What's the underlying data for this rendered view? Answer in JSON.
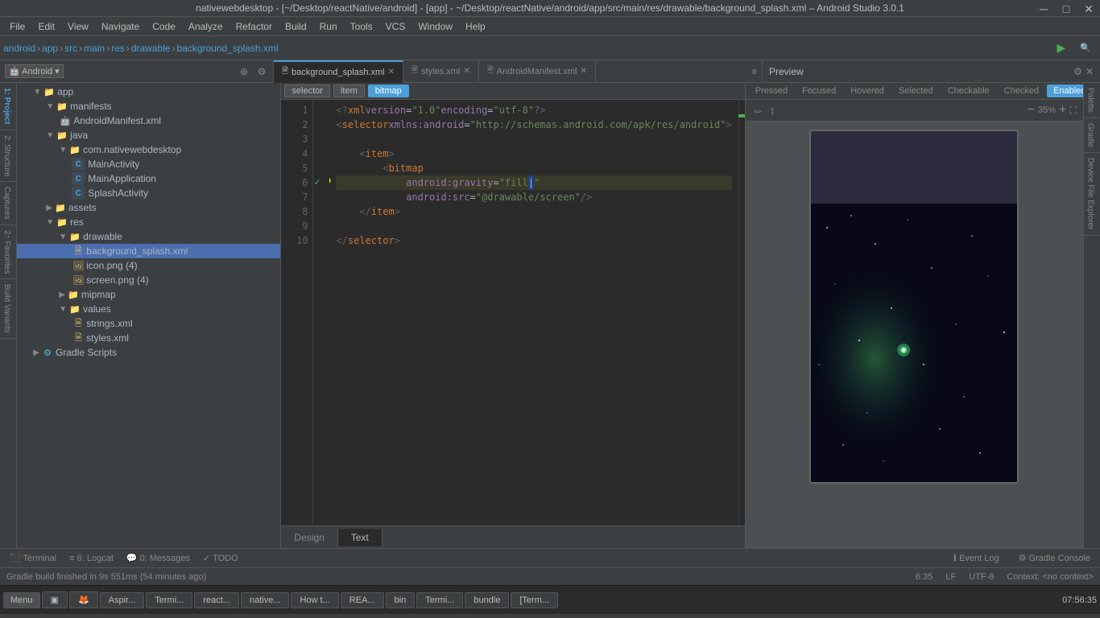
{
  "titleBar": {
    "title": "nativewebdesktop - [~/Desktop/reactNative/android] - [app] - ~/Desktop/reactNative/android/app/src/main/res/drawable/background_splash.xml – Android Studio 3.0.1",
    "minimize": "─",
    "maximize": "□",
    "close": "✕"
  },
  "menuBar": {
    "items": [
      "File",
      "Edit",
      "View",
      "Navigate",
      "Code",
      "Analyze",
      "Refactor",
      "Build",
      "Run",
      "Tools",
      "VCS",
      "Window",
      "Help"
    ]
  },
  "toolbar": {
    "androidLabel": "android",
    "appLabel": "app",
    "runIcon": "▶",
    "searchIcon": "🔍"
  },
  "breadcrumb": {
    "items": [
      "android",
      "app",
      "src",
      "main",
      "res",
      "drawable",
      "background_splash.xml"
    ]
  },
  "projectPanel": {
    "dropdownLabel": "Android",
    "rootItems": [
      {
        "id": "app",
        "label": "app",
        "type": "folder",
        "level": 0,
        "expanded": true
      },
      {
        "id": "manifests",
        "label": "manifests",
        "type": "folder",
        "level": 1,
        "expanded": true
      },
      {
        "id": "AndroidManifest",
        "label": "AndroidManifest.xml",
        "type": "xml",
        "level": 2
      },
      {
        "id": "java",
        "label": "java",
        "type": "folder",
        "level": 1,
        "expanded": true
      },
      {
        "id": "com",
        "label": "com.nativewebdesktop",
        "type": "folder",
        "level": 2,
        "expanded": true
      },
      {
        "id": "MainActivity",
        "label": "MainActivity",
        "type": "java",
        "level": 3
      },
      {
        "id": "MainApplication",
        "label": "MainApplication",
        "type": "java",
        "level": 3
      },
      {
        "id": "SplashActivity",
        "label": "SplashActivity",
        "type": "java",
        "level": 3
      },
      {
        "id": "assets",
        "label": "assets",
        "type": "folder",
        "level": 1,
        "expanded": false
      },
      {
        "id": "res",
        "label": "res",
        "type": "folder",
        "level": 1,
        "expanded": true
      },
      {
        "id": "drawable",
        "label": "drawable",
        "type": "folder",
        "level": 2,
        "expanded": true
      },
      {
        "id": "background_splash",
        "label": "background_splash.xml",
        "type": "xml",
        "level": 3,
        "selected": true
      },
      {
        "id": "icon_png",
        "label": "icon.png (4)",
        "type": "file",
        "level": 3
      },
      {
        "id": "screen_png",
        "label": "screen.png (4)",
        "type": "file",
        "level": 3
      },
      {
        "id": "mipmap",
        "label": "mipmap",
        "type": "folder",
        "level": 2,
        "expanded": false
      },
      {
        "id": "values",
        "label": "values",
        "type": "folder",
        "level": 2,
        "expanded": true
      },
      {
        "id": "strings_xml",
        "label": "strings.xml",
        "type": "xml",
        "level": 3
      },
      {
        "id": "styles_xml",
        "label": "styles.xml",
        "type": "xml",
        "level": 3
      },
      {
        "id": "GradleScripts",
        "label": "Gradle Scripts",
        "type": "gradle",
        "level": 0,
        "expanded": false
      }
    ]
  },
  "editorTabs": [
    {
      "id": "background_splash_xml",
      "label": "background_splash.xml",
      "icon": "🗎",
      "active": true
    },
    {
      "id": "styles_xml",
      "label": "styles.xml",
      "icon": "🗎",
      "active": false
    },
    {
      "id": "AndroidManifest_xml",
      "label": "AndroidManifest.xml",
      "icon": "🗎",
      "active": false
    }
  ],
  "editorSubtabs": [
    {
      "id": "selector",
      "label": "selector",
      "active": false
    },
    {
      "id": "item",
      "label": "item",
      "active": false
    },
    {
      "id": "bitmap",
      "label": "bitmap",
      "active": true
    }
  ],
  "codeLines": [
    {
      "num": 1,
      "content": "<?xml version=\"1.0\" encoding=\"utf-8\"?>",
      "type": "xml_declaration"
    },
    {
      "num": 2,
      "content": "<selector xmlns:android=\"http://schemas.android.com/apk/res/android\">",
      "type": "tag"
    },
    {
      "num": 3,
      "content": "",
      "type": "empty"
    },
    {
      "num": 4,
      "content": "    <item>",
      "type": "tag"
    },
    {
      "num": 5,
      "content": "        <bitmap",
      "type": "tag"
    },
    {
      "num": 6,
      "content": "            android:gravity=\"fill\"",
      "type": "attr",
      "highlighted": true
    },
    {
      "num": 7,
      "content": "            android:src=\"@drawable/screen\"/>",
      "type": "attr"
    },
    {
      "num": 8,
      "content": "    </item>",
      "type": "tag"
    },
    {
      "num": 9,
      "content": "",
      "type": "empty"
    },
    {
      "num": 10,
      "content": "</selector>",
      "type": "tag"
    }
  ],
  "preview": {
    "title": "Preview",
    "stateTabs": [
      "Pressed",
      "Focused",
      "Hovered",
      "Selected",
      "Checkable",
      "Checked",
      "Enabled"
    ],
    "activeStateTab": "Enabled",
    "zoomPercent": "35%"
  },
  "designTextTabs": {
    "tabs": [
      "Design",
      "Text"
    ],
    "activeTab": "Text"
  },
  "statusBar": {
    "buildStatus": "Gradle build finished in 9s 551ms (54 minutes ago)",
    "line": "6:35",
    "lf": "LF",
    "encoding": "UTF-8",
    "context": "Context: <no context>"
  },
  "bottomTools": [
    {
      "id": "terminal",
      "label": "Terminal",
      "icon": "⬛"
    },
    {
      "id": "logcat",
      "label": "6: Logcat",
      "icon": "≡"
    },
    {
      "id": "messages",
      "label": "0: Messages",
      "icon": "💬"
    },
    {
      "id": "todo",
      "label": "TODO",
      "icon": "✓"
    }
  ],
  "rightPanels": {
    "palette": "Palette",
    "structure": "2: Structure",
    "captures": "Captures",
    "buildVariants": "Build Variants",
    "gradle": "Gradle",
    "deviceFileExplorer": "Device File Explorer",
    "preview": "Preview"
  },
  "taskbar": {
    "buttons": [
      {
        "id": "menu",
        "label": "Menu",
        "active": false
      },
      {
        "id": "taskbar1",
        "label": "▣",
        "active": false
      },
      {
        "id": "firefox",
        "label": "🦊",
        "active": false
      },
      {
        "id": "aspiri",
        "label": "Aspir...",
        "active": false
      },
      {
        "id": "termi1",
        "label": "Termi...",
        "active": false
      },
      {
        "id": "react",
        "label": "react...",
        "active": false
      },
      {
        "id": "native",
        "label": "native...",
        "active": false
      },
      {
        "id": "howto",
        "label": "How t...",
        "active": false
      },
      {
        "id": "rea",
        "label": "REA...",
        "active": false
      },
      {
        "id": "bin",
        "label": "bin",
        "active": false
      },
      {
        "id": "termi2",
        "label": "Termi...",
        "active": false
      },
      {
        "id": "bundle",
        "label": "bundle",
        "active": false
      },
      {
        "id": "termi3",
        "label": "[Term...",
        "active": false
      }
    ],
    "time": "07:56:35",
    "eventLog": "Event Log",
    "gradleConsole": "Gradle Console"
  }
}
